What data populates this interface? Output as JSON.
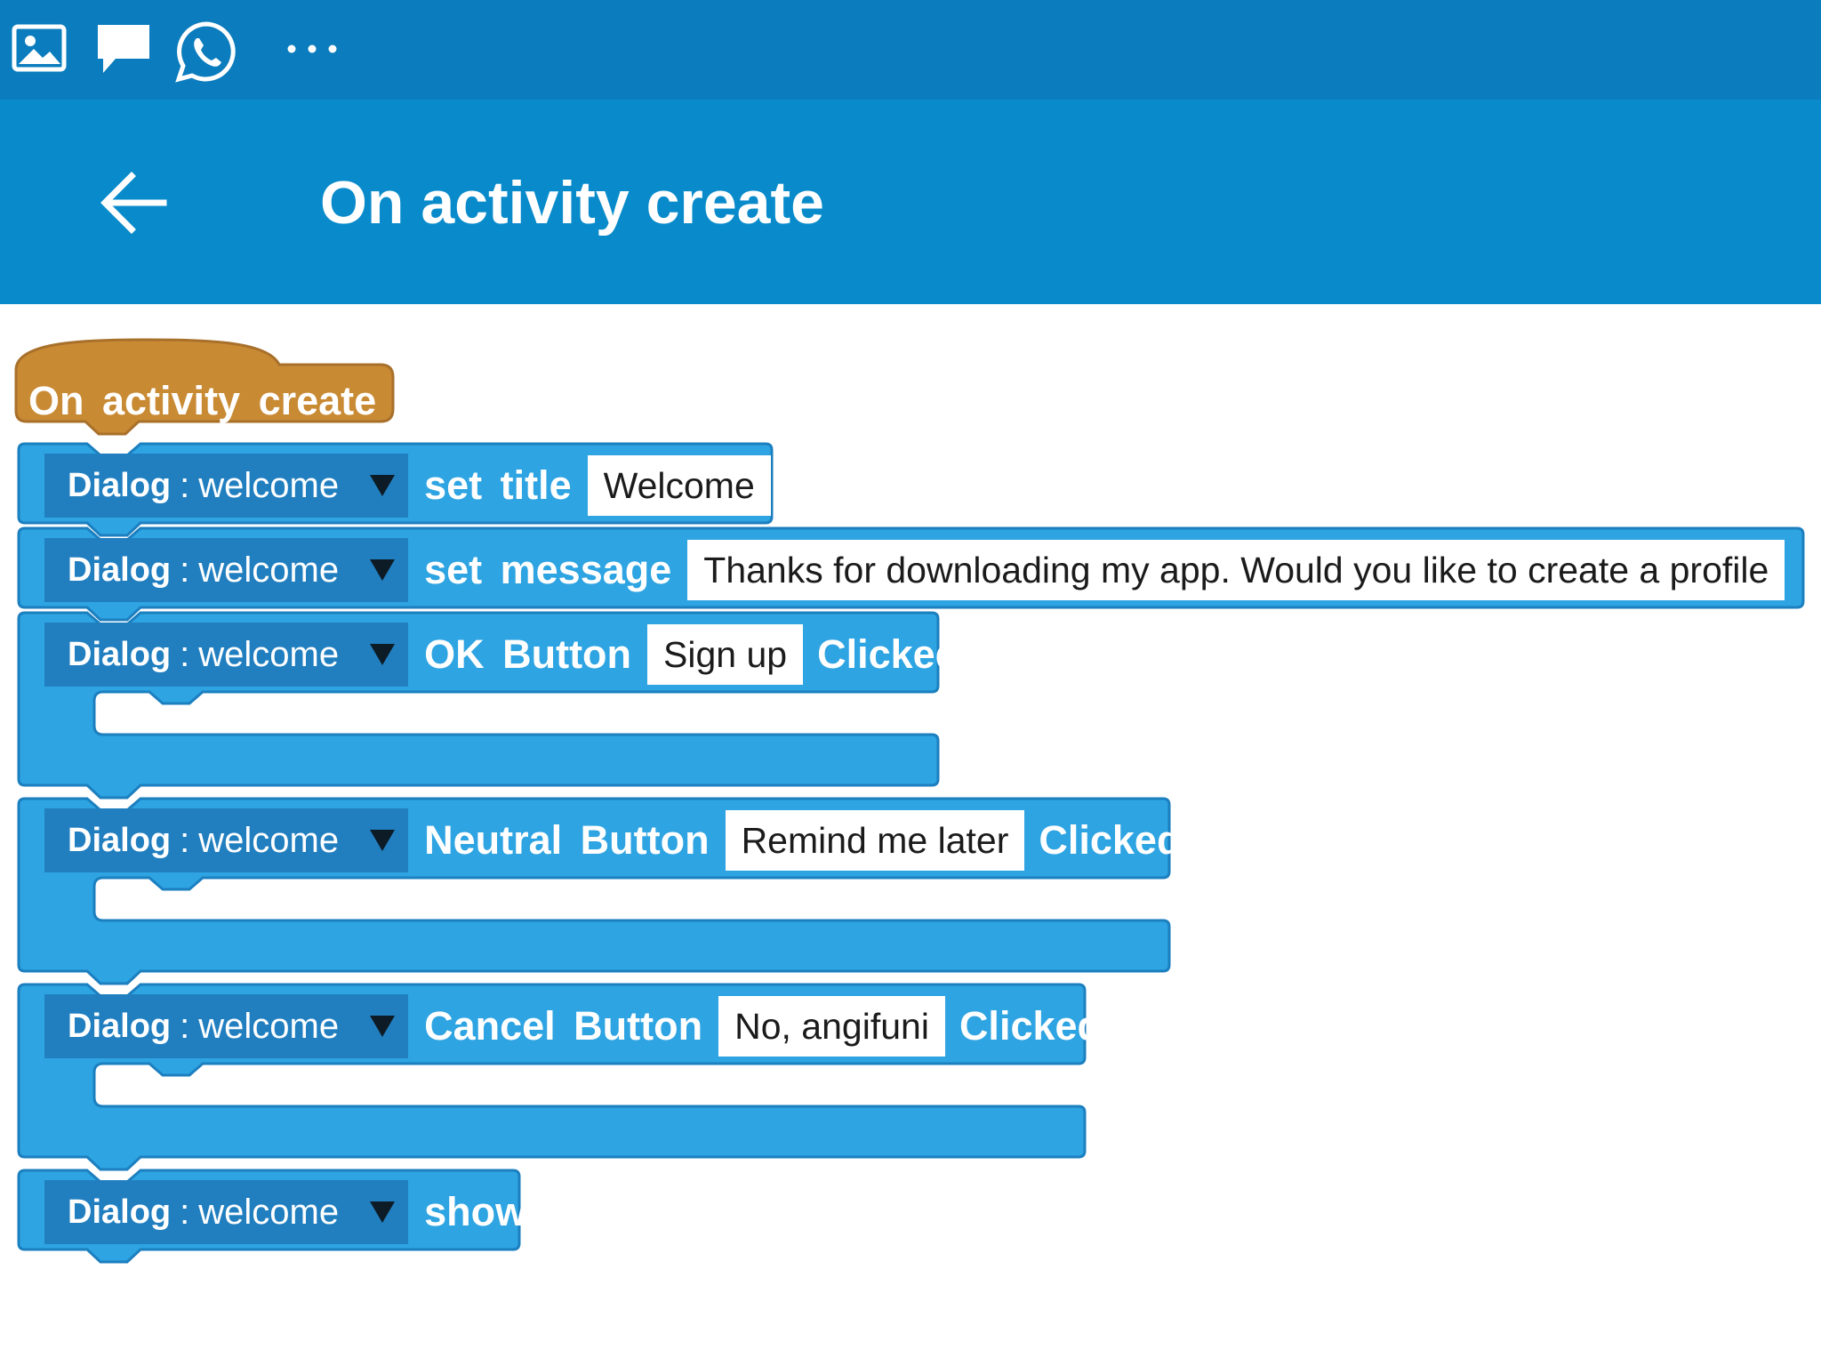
{
  "status_bar": {
    "icons": [
      "gallery-icon",
      "chat-icon",
      "whatsapp-icon",
      "more-icon"
    ]
  },
  "app_bar": {
    "title": "On activity create",
    "back_icon": "arrow-left-icon"
  },
  "colors": {
    "status_bar": "#0b7cbd",
    "app_bar": "#098bcb",
    "block_blue": "#2ea4e2",
    "block_dark": "#217fc0",
    "event_orange": "#c98a34"
  },
  "event_block": {
    "label": "On activity create"
  },
  "blocks": [
    {
      "component_type": "Dialog",
      "separator": ":",
      "component_name": "welcome",
      "action": "set title",
      "value": "Welcome"
    },
    {
      "component_type": "Dialog",
      "separator": ":",
      "component_name": "welcome",
      "action": "set message",
      "value": "Thanks for downloading my app. Would you like to create a profile"
    },
    {
      "component_type": "Dialog",
      "separator": ":",
      "component_name": "welcome",
      "action": "OK Button",
      "value": "Sign up",
      "suffix": "Clicked"
    },
    {
      "component_type": "Dialog",
      "separator": ":",
      "component_name": "welcome",
      "action": "Neutral Button",
      "value": "Remind me later",
      "suffix": "Clicked"
    },
    {
      "component_type": "Dialog",
      "separator": ":",
      "component_name": "welcome",
      "action": "Cancel Button",
      "value": "No, angifuni",
      "suffix": "Clicked"
    },
    {
      "component_type": "Dialog",
      "separator": ":",
      "component_name": "welcome",
      "action": "show"
    }
  ]
}
